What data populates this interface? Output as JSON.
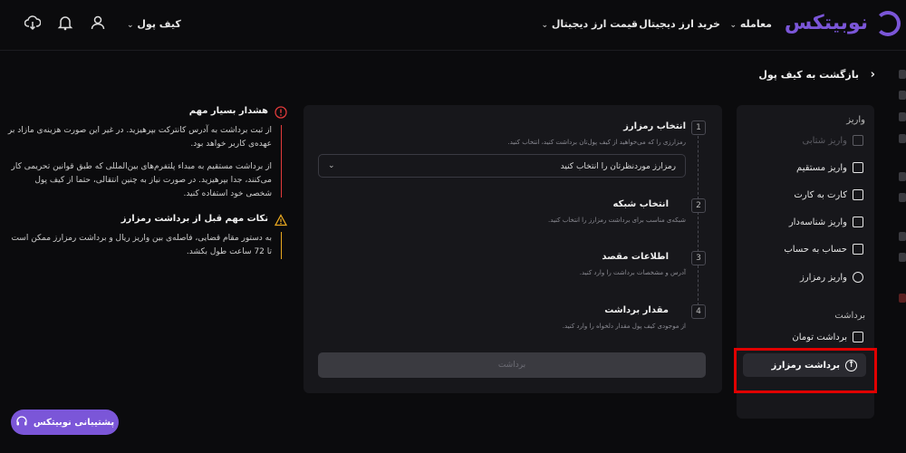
{
  "header": {
    "brand": "نوبیتکس",
    "nav": [
      {
        "label": "معامله"
      },
      {
        "label": "خرید ارز دیجیتال"
      },
      {
        "label": "قیمت ارز دیجیتال"
      }
    ],
    "wallet_label": "کیف پول",
    "icons": [
      "user-icon",
      "bell-icon",
      "download-icon"
    ]
  },
  "back_link": "بازگشت به کیف پول",
  "sidebar": {
    "deposit_heading": "واریز",
    "deposit_items": [
      {
        "label": "واریز شتابی",
        "icon": "card-icon",
        "disabled": true
      },
      {
        "label": "واریز مستقیم",
        "icon": "bank-card-icon",
        "disabled": false
      },
      {
        "label": "کارت به کارت",
        "icon": "card-transfer-icon",
        "disabled": false
      },
      {
        "label": "واریز شناسه‌دار",
        "icon": "checkbox-icon",
        "disabled": false
      },
      {
        "label": "حساب به حساب",
        "icon": "bank-icon",
        "disabled": false
      },
      {
        "label": "واریز رمزارز",
        "icon": "crypto-deposit-icon",
        "disabled": false
      }
    ],
    "withdraw_heading": "برداشت",
    "withdraw_items": [
      {
        "label": "برداشت تومان",
        "icon": "card-icon",
        "active": false
      },
      {
        "label": "برداشت رمزارز",
        "icon": "crypto-withdraw-icon",
        "active": true
      }
    ]
  },
  "steps": [
    {
      "num": "1",
      "title": "انتخاب رمزارز",
      "desc": "رمزارزی را که می‌خواهید از کیف پول‌تان برداشت کنید، انتخاب کنید."
    },
    {
      "num": "2",
      "title": "انتخاب شبکه",
      "desc": "شبکه‌ی مناسب برای برداشت رمزارز را انتخاب کنید."
    },
    {
      "num": "3",
      "title": "اطلاعات مقصد",
      "desc": "آدرس و مشخصات برداشت را وارد کنید."
    },
    {
      "num": "4",
      "title": "مقدار برداشت",
      "desc": "از موجودی کیف پول مقدار دلخواه را وارد کنید."
    }
  ],
  "coin_select": {
    "placeholder": "رمزارز موردنظرتان را انتخاب کنید"
  },
  "submit_label": "برداشت",
  "warnings": {
    "important_title": "هشدار بسیار مهم",
    "important_p1": "از ثبت برداشت به آدرس کانترکت بپرهیزید. در غیر این صورت هزینه‌ی مازاد بر عهده‌ی کاربر خواهد بود.",
    "important_p2": "از برداشت مستقیم به مبداء پلتفرم‌های بین‌المللی که طبق قوانین تحریمی کار می‌کنند، جدا بپرهیزید. در صورت نیاز به چنین انتقالی، حتما از کیف پول شخصی خود استفاده کنید.",
    "notes_title": "نکات مهم قبل از برداشت رمزارز",
    "notes_p1": "به دستور مقام قضایی، فاصله‌ی بین واریز ریال و برداشت رمزارز ممکن است تا 72 ساعت طول بکشد."
  },
  "support_label": "پشتیبانی نوبیتکس",
  "colors": {
    "accent": "#7b56d8",
    "danger": "#e23b3b",
    "warning": "#e8a820",
    "highlight": "#e00000"
  }
}
